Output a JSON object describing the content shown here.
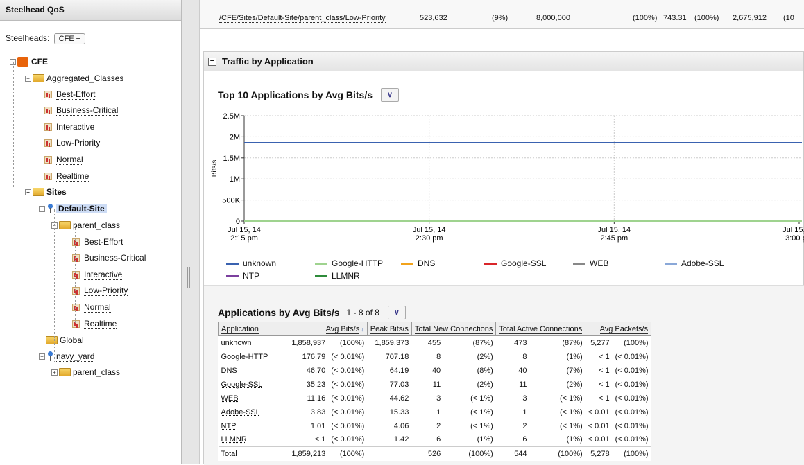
{
  "left": {
    "title": "Steelhead QoS",
    "selector_label": "Steelheads:",
    "selector_value": "CFE",
    "tree": {
      "root": "CFE",
      "aggregated": "Aggregated_Classes",
      "agg_items": [
        "Best-Effort",
        "Business-Critical",
        "Interactive",
        "Low-Priority",
        "Normal",
        "Realtime"
      ],
      "sites": "Sites",
      "default_site": "Default-Site",
      "parent_class": "parent_class",
      "site_items": [
        "Best-Effort",
        "Business-Critical",
        "Interactive",
        "Low-Priority",
        "Normal",
        "Realtime"
      ],
      "global": "Global",
      "navy_yard": "navy_yard",
      "navy_parent": "parent_class"
    }
  },
  "top_row": {
    "path": "/CFE/Sites/Default-Site/parent_class/Low-Priority",
    "v1": "523,632",
    "v2": "(9%)",
    "v3": "8,000,000",
    "v4": "(100%)",
    "v5": "743.31",
    "v6": "(100%)",
    "v7": "2,675,912",
    "v8": "(10"
  },
  "panel": {
    "title": "Traffic by Application",
    "chart_title": "Top 10 Applications by Avg Bits/s",
    "table_title": "Applications by Avg Bits/s",
    "pager": "1 - 8 of 8"
  },
  "chart_data": {
    "type": "line",
    "ylabel": "Bits/s",
    "ylim": [
      0,
      2500000
    ],
    "yticks": [
      "2.5M",
      "2M",
      "1.5M",
      "1M",
      "500K",
      "0"
    ],
    "xticks": [
      [
        "Jul 15, 14",
        "2:15 pm"
      ],
      [
        "Jul 15, 14",
        "2:30 pm"
      ],
      [
        "Jul 15, 14",
        "2:45 pm"
      ],
      [
        "Jul 15, 14",
        "3:00 pm"
      ]
    ],
    "series": [
      {
        "name": "unknown",
        "color": "#3a62b0",
        "values": [
          1858937,
          1858937
        ]
      },
      {
        "name": "Google-HTTP",
        "color": "#9fd38f",
        "values": [
          177,
          177
        ]
      },
      {
        "name": "DNS",
        "color": "#f2a31b",
        "values": [
          47,
          47
        ]
      },
      {
        "name": "Google-SSL",
        "color": "#d9252a",
        "values": [
          35,
          35
        ]
      },
      {
        "name": "WEB",
        "color": "#888888",
        "values": [
          11,
          11
        ]
      },
      {
        "name": "Adobe-SSL",
        "color": "#8aa8d8",
        "values": [
          4,
          4
        ]
      },
      {
        "name": "NTP",
        "color": "#7b3f9e",
        "values": [
          1,
          1
        ]
      },
      {
        "name": "LLMNR",
        "color": "#2e8b3a",
        "values": [
          1,
          1
        ]
      }
    ]
  },
  "table": {
    "headers": [
      "Application",
      "Avg Bits/s",
      "Peak Bits/s",
      "Total New Connections",
      "Total Active Connections",
      "Avg Packets/s"
    ],
    "sort_icon": "sort-down-icon",
    "rows": [
      [
        "unknown",
        "1,858,937",
        "(100%)",
        "1,859,373",
        "455",
        "(87%)",
        "473",
        "(87%)",
        "5,277",
        "(100%)"
      ],
      [
        "Google-HTTP",
        "176.79",
        "(< 0.01%)",
        "707.18",
        "8",
        "(2%)",
        "8",
        "(1%)",
        "< 1",
        "(< 0.01%)"
      ],
      [
        "DNS",
        "46.70",
        "(< 0.01%)",
        "64.19",
        "40",
        "(8%)",
        "40",
        "(7%)",
        "< 1",
        "(< 0.01%)"
      ],
      [
        "Google-SSL",
        "35.23",
        "(< 0.01%)",
        "77.03",
        "11",
        "(2%)",
        "11",
        "(2%)",
        "< 1",
        "(< 0.01%)"
      ],
      [
        "WEB",
        "11.16",
        "(< 0.01%)",
        "44.62",
        "3",
        "(< 1%)",
        "3",
        "(< 1%)",
        "< 1",
        "(< 0.01%)"
      ],
      [
        "Adobe-SSL",
        "3.83",
        "(< 0.01%)",
        "15.33",
        "1",
        "(< 1%)",
        "1",
        "(< 1%)",
        "< 0.01",
        "(< 0.01%)"
      ],
      [
        "NTP",
        "1.01",
        "(< 0.01%)",
        "4.06",
        "2",
        "(< 1%)",
        "2",
        "(< 1%)",
        "< 0.01",
        "(< 0.01%)"
      ],
      [
        "LLMNR",
        "< 1",
        "(< 0.01%)",
        "1.42",
        "6",
        "(1%)",
        "6",
        "(1%)",
        "< 0.01",
        "(< 0.01%)"
      ]
    ],
    "total": [
      "Total",
      "1,859,213",
      "(100%)",
      "",
      "526",
      "(100%)",
      "544",
      "(100%)",
      "5,278",
      "(100%)"
    ]
  }
}
